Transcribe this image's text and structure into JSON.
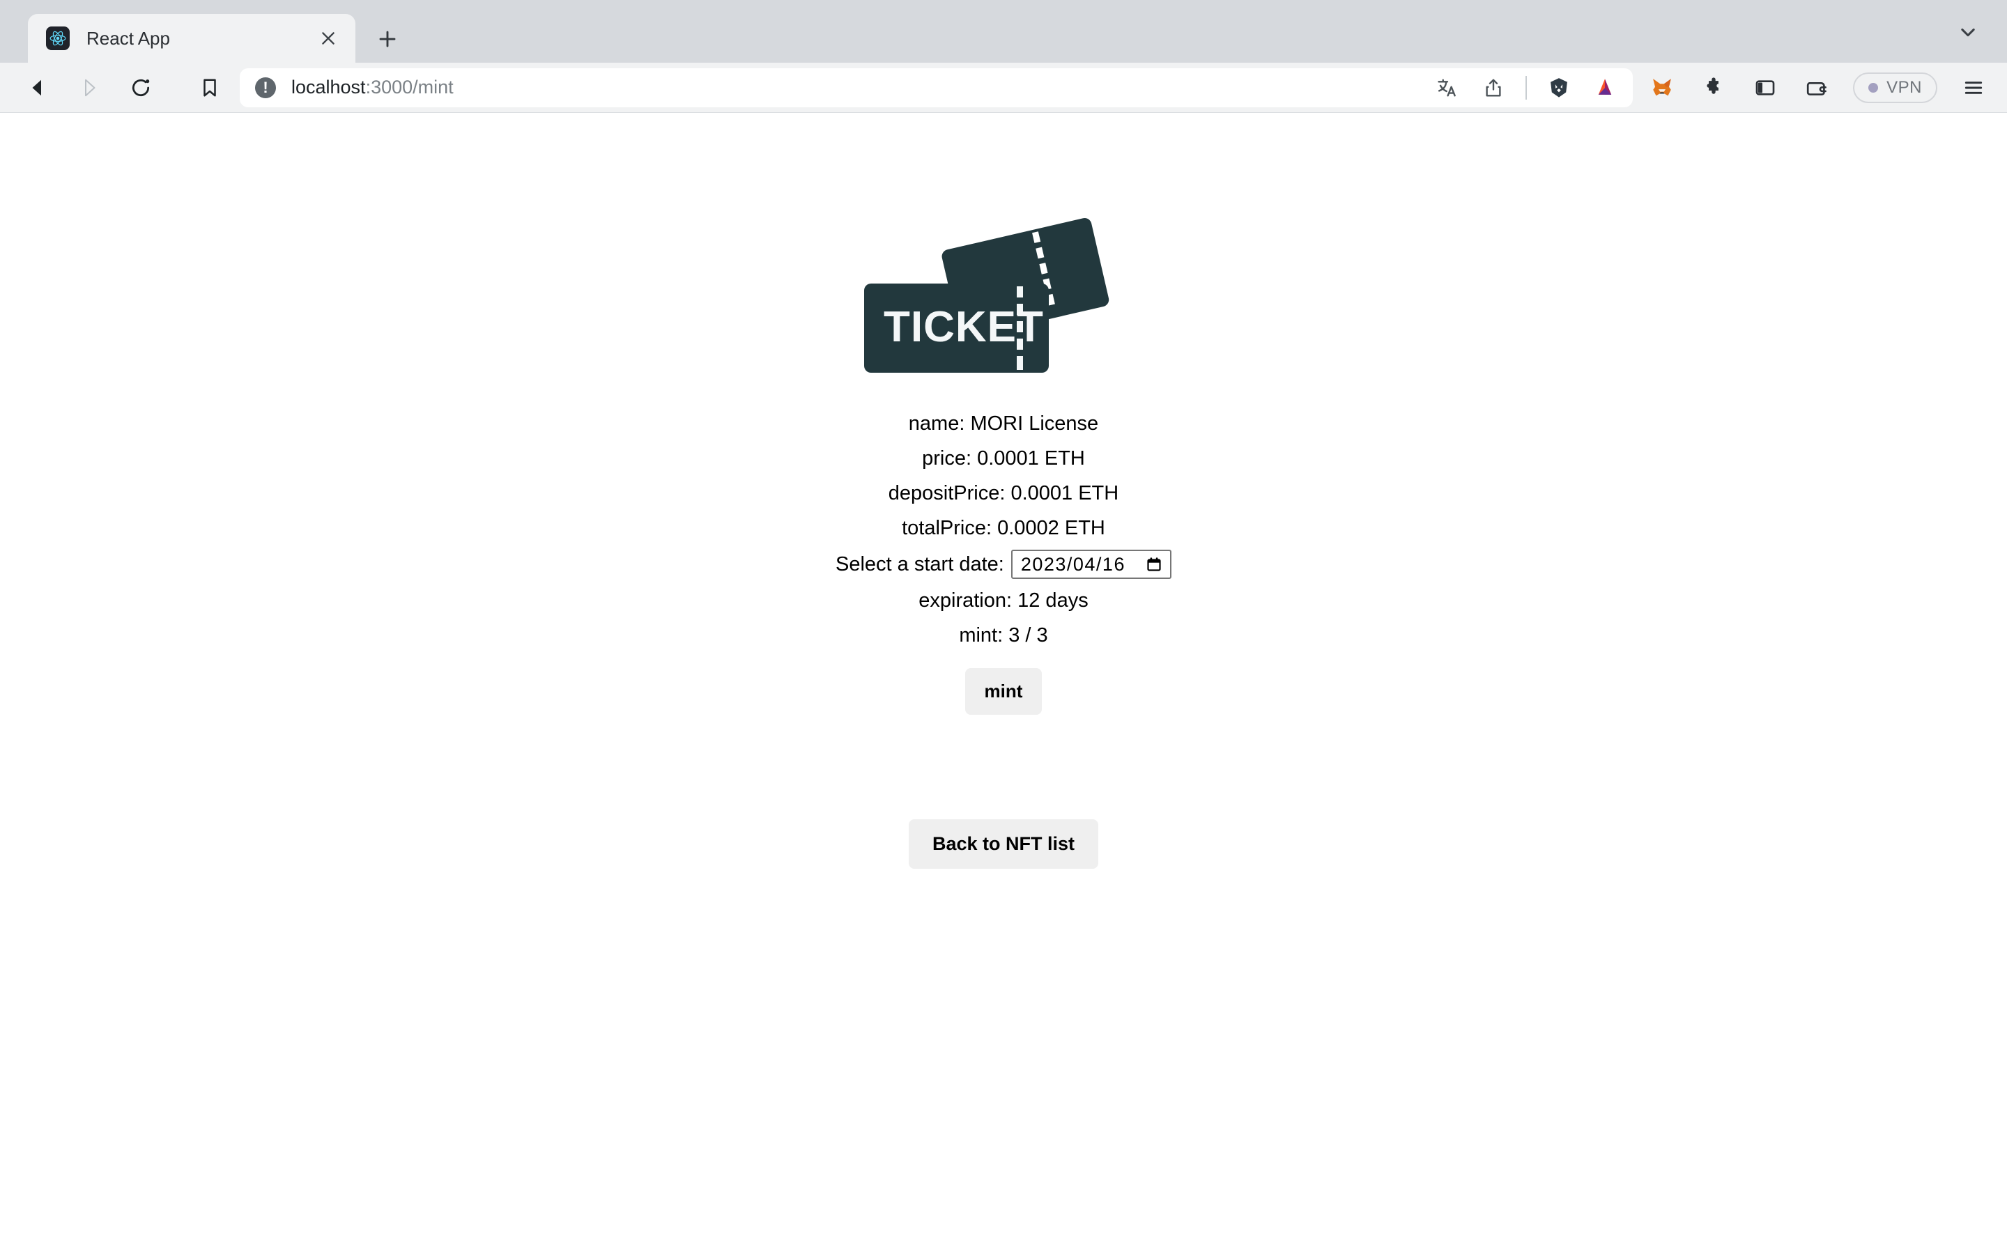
{
  "browser": {
    "tab": {
      "title": "React App",
      "favicon_icon": "react-logo-icon",
      "close_icon": "close-icon"
    },
    "new_tab_icon": "plus-icon",
    "tab_list_chevron_icon": "chevron-down-icon",
    "nav": {
      "back_icon": "back-arrow-icon",
      "forward_icon": "forward-arrow-icon",
      "reload_icon": "reload-icon",
      "bookmark_icon": "bookmark-icon"
    },
    "address_bar": {
      "security_icon": "info-circle-icon",
      "url_host": "localhost",
      "url_rest": ":3000/mint",
      "url_full": "localhost:3000/mint",
      "translate_icon": "translate-icon",
      "share_icon": "share-icon",
      "brave_shield_icon": "brave-lion-icon",
      "bat_rewards_icon": "bat-triangle-icon"
    },
    "toolbar_right": {
      "metamask_icon": "metamask-fox-icon",
      "extensions_icon": "puzzle-piece-icon",
      "sidebar_icon": "sidebar-panel-icon",
      "wallet_icon": "wallet-icon",
      "vpn_label": "VPN",
      "vpn_status_icon": "status-dot-icon",
      "menu_icon": "hamburger-menu-icon"
    }
  },
  "page": {
    "artwork": {
      "name": "ticket-illustration",
      "label": "TICKET",
      "color": "#22383d"
    },
    "details": [
      "name: MORI License",
      "price: 0.0001 ETH",
      "depositPrice: 0.0001 ETH",
      "totalPrice: 0.0002 ETH"
    ],
    "date_field": {
      "label": "Select a start date:",
      "value": "2023/04/16",
      "calendar_icon": "calendar-icon"
    },
    "expiration": "expiration: 12 days",
    "mint_count": "mint: 3 / 3",
    "mint_button": "mint",
    "back_button": "Back to NFT list"
  }
}
